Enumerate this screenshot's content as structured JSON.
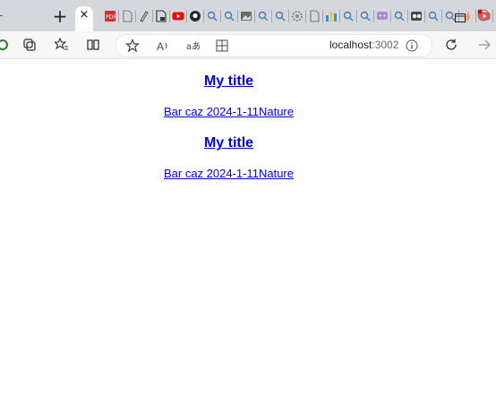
{
  "browser": {
    "new_tab_glyph": "+",
    "close_tab_glyph": "×",
    "url_host": "localhost",
    "url_port": ":3002",
    "pinned_tabs": [
      {
        "icon": "pdf-icon",
        "color": "#d32f2f"
      },
      {
        "icon": "document-icon",
        "color": "#777777"
      },
      {
        "icon": "marker-icon",
        "color": "#555555"
      },
      {
        "icon": "file-lock-icon",
        "color": "#333333"
      },
      {
        "icon": "youtube-icon",
        "color": "#ff0000"
      },
      {
        "icon": "github-icon",
        "color": "#24292e"
      },
      {
        "icon": "search-icon",
        "color": "#4a7ab0"
      },
      {
        "icon": "search-icon",
        "color": "#4a7ab0"
      },
      {
        "icon": "image-icon",
        "color": "#6b6b6b"
      },
      {
        "icon": "search-icon",
        "color": "#4a7ab0"
      },
      {
        "icon": "search-icon",
        "color": "#4a7ab0"
      },
      {
        "icon": "gear-icon",
        "color": "#8a8a8a"
      },
      {
        "icon": "document-icon",
        "color": "#777777"
      },
      {
        "icon": "bar-chart-icon",
        "color": "#3a8fd0"
      },
      {
        "icon": "search-icon",
        "color": "#4a7ab0"
      },
      {
        "icon": "search-icon",
        "color": "#4a7ab0"
      },
      {
        "icon": "chat-icon",
        "color": "#a98bd6"
      },
      {
        "icon": "search-icon",
        "color": "#4a7ab0"
      },
      {
        "icon": "record-icon",
        "color": "#444444"
      },
      {
        "icon": "search-icon",
        "color": "#4a7ab0"
      },
      {
        "icon": "search-icon",
        "color": "#4a7ab0"
      },
      {
        "icon": "flame-icon",
        "color": "#f0a070"
      },
      {
        "icon": "youtube-icon",
        "color": "#e05555"
      },
      {
        "icon": "chart-icon",
        "color": "#5b7fc0"
      }
    ]
  },
  "posts": [
    {
      "title": "My title",
      "meta": "Bar caz 2024-1-11Nature"
    },
    {
      "title": "My title",
      "meta": "Bar caz 2024-1-11Nature"
    }
  ]
}
